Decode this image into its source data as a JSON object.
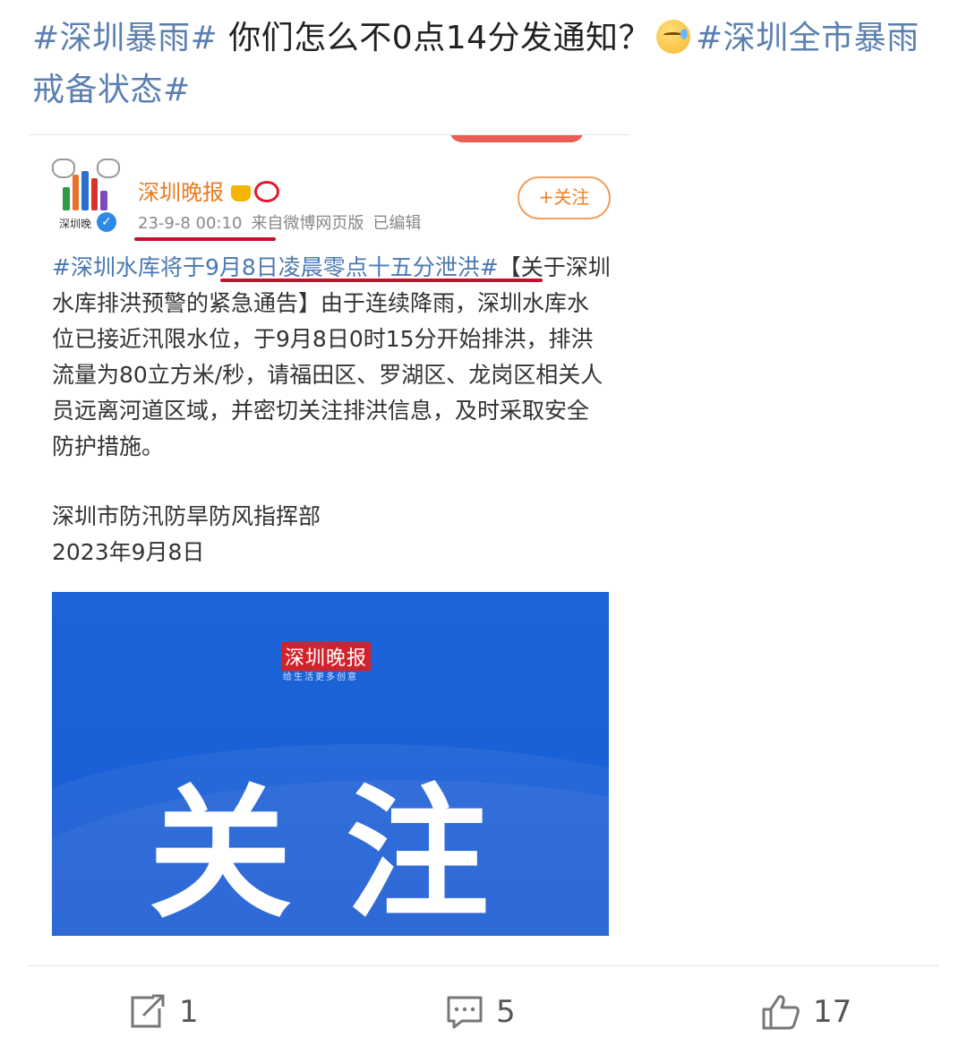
{
  "post": {
    "tag1": "#深圳暴雨#",
    "text": " 你们怎么不0点14分发通知？",
    "emoji": "sweat-face-emoji",
    "tag2": "#深圳全市暴雨戒备状态#"
  },
  "embedded": {
    "account": "深圳晚报",
    "avatar_caption": "深圳晚",
    "timestamp": "23-9-8 00:10",
    "source": "来自微博网页版",
    "edited": "已编辑",
    "follow_label": "+关注",
    "topic": "#深圳水库将于9月8日凌晨零点十五分泄洪#",
    "body": "【关于深圳水库排洪预警的紧急通告】由于连续降雨，深圳水库水位已接近汛限水位，于9月8日0时15分开始排洪，排洪流量为80立方米/秒，请福田区、罗湖区、龙岗区相关人员远离河道区域，并密切关注排洪信息，及时采取安全防护措施。",
    "sign_org": "深圳市防汛防旱防风指挥部",
    "sign_date": "2023年9月8日",
    "image": {
      "logo": "深圳晚报",
      "slogan": "给生活更多创意",
      "headline": "关注"
    }
  },
  "actions": {
    "repost_count": "1",
    "comment_count": "5",
    "like_count": "17"
  },
  "colors": {
    "tag": "#5b7fb0",
    "highlight_underline": "#c8102e",
    "image_bg": "#1a5fd6",
    "username": "#e77b22"
  }
}
